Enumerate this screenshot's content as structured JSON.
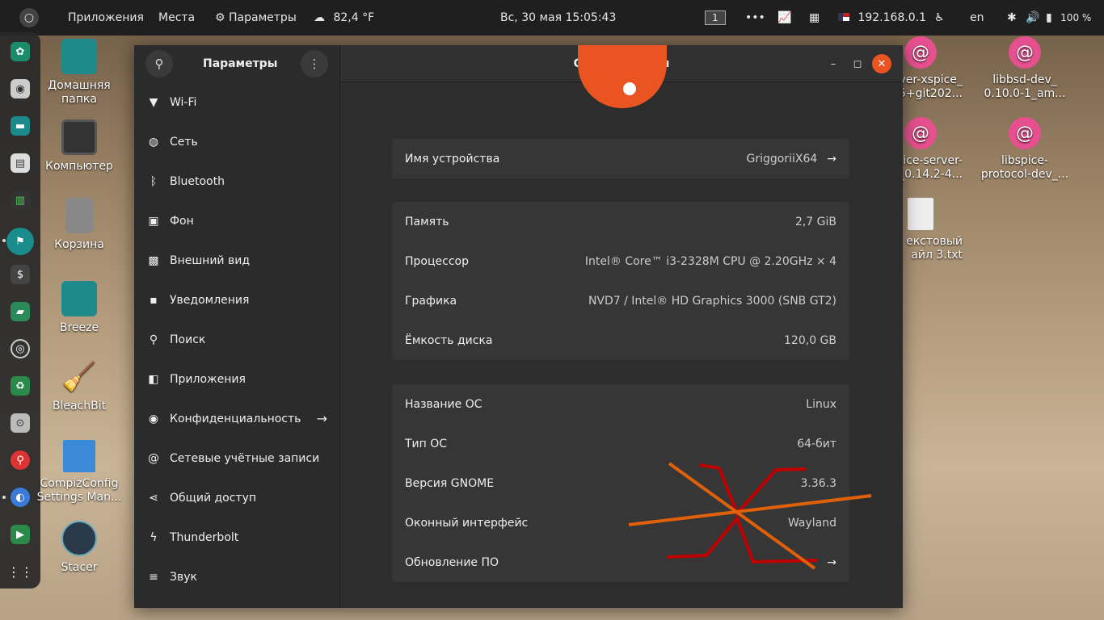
{
  "topbar": {
    "activities": "○",
    "apps": "Приложения",
    "places": "Места",
    "settings": "Параметры",
    "weather": "82,4 °F",
    "clock": "Вс, 30 мая  15:05:43",
    "workspace": "1",
    "ip": "192.168.0.1",
    "lang": "en",
    "battery": "100 %"
  },
  "desktop": {
    "home": "Домашняя папка",
    "computer": "Компьютер",
    "trash": "Корзина",
    "breeze": "Breeze",
    "bleachbit": "BleachBit",
    "compiz": "CompizConfig Settings Man...",
    "stacer": "Stacer",
    "xspice": "ver-xspice_ 5+git202...",
    "libbsd": "libbsd-dev_ 0.10.0-1_am...",
    "spiceserver": "pice-server- _0.14.2-4...",
    "libspice": "libspice- protocol-dev_...",
    "textfile": "екстовый айл 3.txt"
  },
  "window": {
    "sidebar_title": "Параметры",
    "title": "О приложении",
    "sidebar": [
      {
        "icon": "wifi-icon",
        "label": "Wi-Fi"
      },
      {
        "icon": "network-icon",
        "label": "Сеть"
      },
      {
        "icon": "bluetooth-icon",
        "label": "Bluetooth"
      },
      {
        "icon": "background-icon",
        "label": "Фон"
      },
      {
        "icon": "appearance-icon",
        "label": "Внешний вид"
      },
      {
        "icon": "notifications-icon",
        "label": "Уведомления"
      },
      {
        "icon": "search-icon",
        "label": "Поиск"
      },
      {
        "icon": "apps-icon",
        "label": "Приложения"
      },
      {
        "icon": "privacy-icon",
        "label": "Конфиденциальность"
      },
      {
        "icon": "online-accounts-icon",
        "label": "Сетевые учётные записи"
      },
      {
        "icon": "sharing-icon",
        "label": "Общий доступ"
      },
      {
        "icon": "thunderbolt-icon",
        "label": "Thunderbolt"
      },
      {
        "icon": "sound-icon",
        "label": "Звук"
      }
    ],
    "device": {
      "label": "Имя устройства",
      "value": "GriggoriiX64"
    },
    "hw": [
      {
        "label": "Память",
        "value": "2,7 GiB"
      },
      {
        "label": "Процессор",
        "value": "Intel® Core™ i3-2328M CPU @ 2.20GHz × 4"
      },
      {
        "label": "Графика",
        "value": "NVD7 / Intel® HD Graphics 3000 (SNB GT2)"
      },
      {
        "label": "Ёмкость диска",
        "value": "120,0 GB"
      }
    ],
    "os": [
      {
        "label": "Название ОС",
        "value": "Linux"
      },
      {
        "label": "Тип ОС",
        "value": "64-бит"
      },
      {
        "label": "Версия GNOME",
        "value": "3.36.3"
      },
      {
        "label": "Оконный интерфейс",
        "value": "Wayland"
      },
      {
        "label": "Обновление ПО",
        "value": ""
      }
    ]
  },
  "colors": {
    "accent": "#e95420",
    "close": "#e95420",
    "scribble_red": "#c00000",
    "scribble_orange": "#e0600a"
  }
}
